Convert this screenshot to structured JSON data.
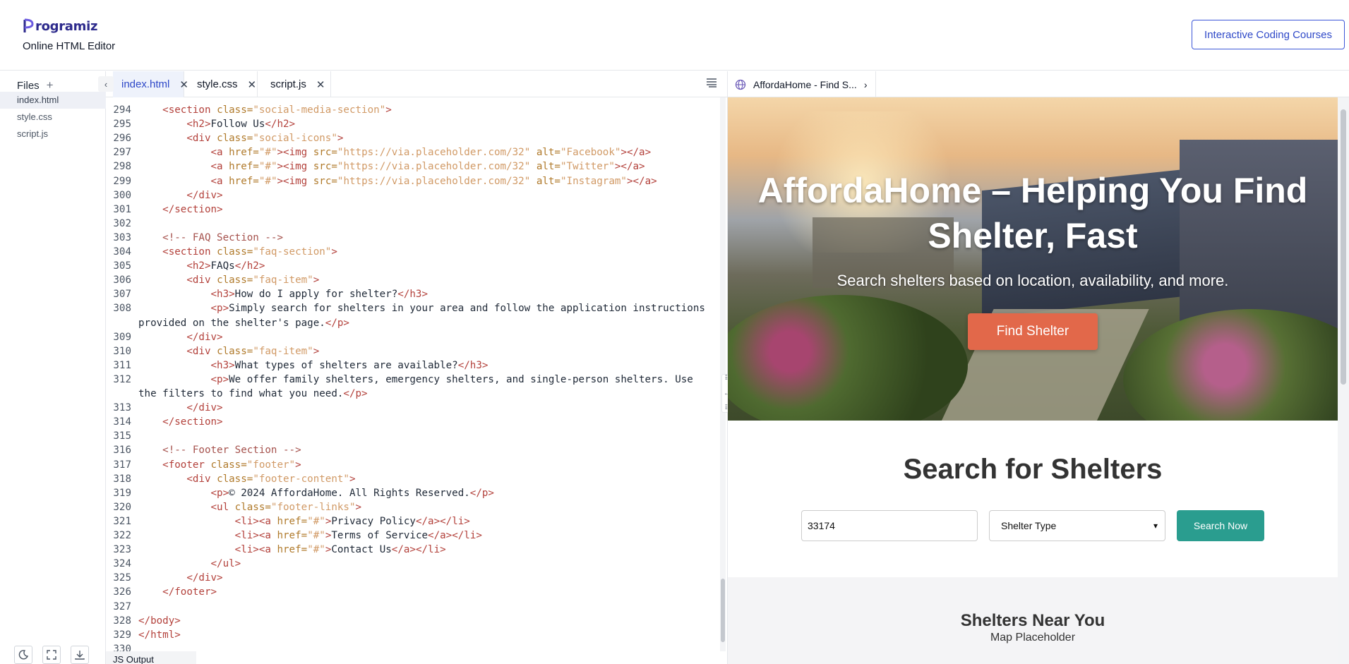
{
  "header": {
    "logo_text": "rogramiz",
    "subtitle": "Online HTML Editor",
    "courses_button": "Interactive Coding Courses"
  },
  "sidebar": {
    "title": "Files",
    "files": [
      "index.html",
      "style.css",
      "script.js"
    ]
  },
  "editor": {
    "tabs": [
      "index.html",
      "style.css",
      "script.js"
    ],
    "active_tab": "index.html",
    "output_tab": "JS Output"
  },
  "code_lines": [
    {
      "n": "294",
      "html": "    <span class='tag'>&lt;section</span> <span class='attr'>class=</span><span class='str'>\"social-media-section\"</span><span class='tag'>&gt;</span>"
    },
    {
      "n": "295",
      "html": "        <span class='tag'>&lt;h2&gt;</span>Follow Us<span class='tag'>&lt;/h2&gt;</span>"
    },
    {
      "n": "296",
      "html": "        <span class='tag'>&lt;div</span> <span class='attr'>class=</span><span class='str'>\"social-icons\"</span><span class='tag'>&gt;</span>"
    },
    {
      "n": "297",
      "html": "            <span class='tag'>&lt;a</span> <span class='attr'>href=</span><span class='str'>\"#\"</span><span class='tag'>&gt;&lt;img</span> <span class='attr'>src=</span><span class='str'>\"https://via.placeholder.com/32\"</span> <span class='attr'>alt=</span><span class='str'>\"Facebook\"</span><span class='tag'>&gt;&lt;/a&gt;</span>"
    },
    {
      "n": "298",
      "html": "            <span class='tag'>&lt;a</span> <span class='attr'>href=</span><span class='str'>\"#\"</span><span class='tag'>&gt;&lt;img</span> <span class='attr'>src=</span><span class='str'>\"https://via.placeholder.com/32\"</span> <span class='attr'>alt=</span><span class='str'>\"Twitter\"</span><span class='tag'>&gt;&lt;/a&gt;</span>"
    },
    {
      "n": "299",
      "html": "            <span class='tag'>&lt;a</span> <span class='attr'>href=</span><span class='str'>\"#\"</span><span class='tag'>&gt;&lt;img</span> <span class='attr'>src=</span><span class='str'>\"https://via.placeholder.com/32\"</span> <span class='attr'>alt=</span><span class='str'>\"Instagram\"</span><span class='tag'>&gt;&lt;/a&gt;</span>"
    },
    {
      "n": "300",
      "html": "        <span class='tag'>&lt;/div&gt;</span>"
    },
    {
      "n": "301",
      "html": "    <span class='tag'>&lt;/section&gt;</span>"
    },
    {
      "n": "302",
      "html": ""
    },
    {
      "n": "303",
      "html": "    <span class='cmt'>&lt;!-- FAQ Section --&gt;</span>"
    },
    {
      "n": "304",
      "html": "    <span class='tag'>&lt;section</span> <span class='attr'>class=</span><span class='str'>\"faq-section\"</span><span class='tag'>&gt;</span>"
    },
    {
      "n": "305",
      "html": "        <span class='tag'>&lt;h2&gt;</span>FAQs<span class='tag'>&lt;/h2&gt;</span>"
    },
    {
      "n": "306",
      "html": "        <span class='tag'>&lt;div</span> <span class='attr'>class=</span><span class='str'>\"faq-item\"</span><span class='tag'>&gt;</span>"
    },
    {
      "n": "307",
      "html": "            <span class='tag'>&lt;h3&gt;</span>How do I apply for shelter?<span class='tag'>&lt;/h3&gt;</span>"
    },
    {
      "n": "308",
      "html": "            <span class='tag'>&lt;p&gt;</span>Simply search for shelters in your area and follow the application instructions"
    },
    {
      "n": "",
      "html": "provided on the shelter's page.<span class='tag'>&lt;/p&gt;</span>"
    },
    {
      "n": "309",
      "html": "        <span class='tag'>&lt;/div&gt;</span>"
    },
    {
      "n": "310",
      "html": "        <span class='tag'>&lt;div</span> <span class='attr'>class=</span><span class='str'>\"faq-item\"</span><span class='tag'>&gt;</span>"
    },
    {
      "n": "311",
      "html": "            <span class='tag'>&lt;h3&gt;</span>What types of shelters are available?<span class='tag'>&lt;/h3&gt;</span>"
    },
    {
      "n": "312",
      "html": "            <span class='tag'>&lt;p&gt;</span>We offer family shelters, emergency shelters, and single-person shelters. Use"
    },
    {
      "n": "",
      "html": "the filters to find what you need.<span class='tag'>&lt;/p&gt;</span>"
    },
    {
      "n": "313",
      "html": "        <span class='tag'>&lt;/div&gt;</span>"
    },
    {
      "n": "314",
      "html": "    <span class='tag'>&lt;/section&gt;</span>"
    },
    {
      "n": "315",
      "html": ""
    },
    {
      "n": "316",
      "html": "    <span class='cmt'>&lt;!-- Footer Section --&gt;</span>"
    },
    {
      "n": "317",
      "html": "    <span class='tag'>&lt;footer</span> <span class='attr'>class=</span><span class='str'>\"footer\"</span><span class='tag'>&gt;</span>"
    },
    {
      "n": "318",
      "html": "        <span class='tag'>&lt;div</span> <span class='attr'>class=</span><span class='str'>\"footer-content\"</span><span class='tag'>&gt;</span>"
    },
    {
      "n": "319",
      "html": "            <span class='tag'>&lt;p&gt;</span>© 2024 AffordaHome. All Rights Reserved.<span class='tag'>&lt;/p&gt;</span>"
    },
    {
      "n": "320",
      "html": "            <span class='tag'>&lt;ul</span> <span class='attr'>class=</span><span class='str'>\"footer-links\"</span><span class='tag'>&gt;</span>"
    },
    {
      "n": "321",
      "html": "                <span class='tag'>&lt;li&gt;&lt;a</span> <span class='attr'>href=</span><span class='str'>\"#\"</span><span class='tag'>&gt;</span>Privacy Policy<span class='tag'>&lt;/a&gt;&lt;/li&gt;</span>"
    },
    {
      "n": "322",
      "html": "                <span class='tag'>&lt;li&gt;&lt;a</span> <span class='attr'>href=</span><span class='str'>\"#\"</span><span class='tag'>&gt;</span>Terms of Service<span class='tag'>&lt;/a&gt;&lt;/li&gt;</span>"
    },
    {
      "n": "323",
      "html": "                <span class='tag'>&lt;li&gt;&lt;a</span> <span class='attr'>href=</span><span class='str'>\"#\"</span><span class='tag'>&gt;</span>Contact Us<span class='tag'>&lt;/a&gt;&lt;/li&gt;</span>"
    },
    {
      "n": "324",
      "html": "            <span class='tag'>&lt;/ul&gt;</span>"
    },
    {
      "n": "325",
      "html": "        <span class='tag'>&lt;/div&gt;</span>"
    },
    {
      "n": "326",
      "html": "    <span class='tag'>&lt;/footer&gt;</span>"
    },
    {
      "n": "327",
      "html": ""
    },
    {
      "n": "328",
      "html": "<span class='tag'>&lt;/body&gt;</span>"
    },
    {
      "n": "329",
      "html": "<span class='tag'>&lt;/html&gt;</span>"
    },
    {
      "n": "330",
      "html": ""
    }
  ],
  "preview": {
    "tab_title": "AffordaHome - Find S...",
    "hero_title": "AffordaHome – Helping You Find Shelter, Fast",
    "hero_subtitle": "Search shelters based on location, availability, and more.",
    "hero_button": "Find Shelter",
    "search_title": "Search for Shelters",
    "zip_value": "33174",
    "type_select": "Shelter Type",
    "search_button": "Search Now",
    "near_title": "Shelters Near You",
    "map_placeholder": "Map Placeholder"
  },
  "colors": {
    "brand": "#2d2a8c",
    "accent_blue": "#3b56d8",
    "hero_button": "#e2684a",
    "search_button": "#2a9d8f"
  }
}
